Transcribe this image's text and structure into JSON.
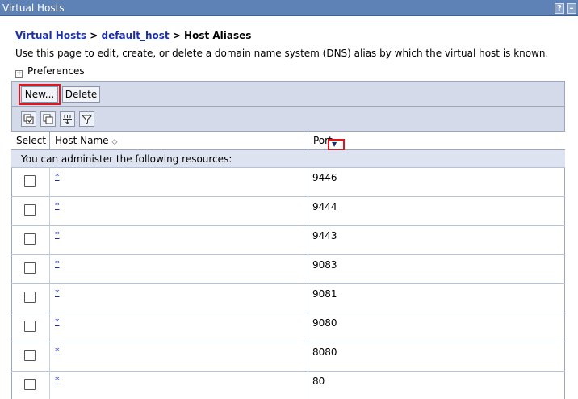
{
  "window": {
    "title": "Virtual Hosts",
    "help_label": "?",
    "minimize_label": "–"
  },
  "breadcrumb": {
    "items": [
      {
        "label": "Virtual Hosts",
        "link": true
      },
      {
        "label": " > ",
        "link": false
      },
      {
        "label": "default_host",
        "link": true
      },
      {
        "label": " > ",
        "link": false
      },
      {
        "label": "Host Aliases",
        "link": false
      }
    ]
  },
  "description": "Use this page to edit, create, or delete a domain name system (DNS) alias by which the virtual host is known.",
  "preferences": {
    "label": "Preferences",
    "toggle": "+"
  },
  "toolbar": {
    "new_label": "New...",
    "delete_label": "Delete"
  },
  "icon_toolbar": [
    "select-all-icon",
    "deselect-all-icon",
    "show-filter-icon",
    "clear-filter-icon"
  ],
  "table": {
    "columns": {
      "select": "Select",
      "host": "Host Name",
      "port": "Port"
    },
    "sort_indicator": "◇",
    "port_menu_icon": "▼",
    "resource_message": "You can administer the following resources:",
    "rows": [
      {
        "host": "*",
        "port": "9446"
      },
      {
        "host": "*",
        "port": "9444"
      },
      {
        "host": "*",
        "port": "9443"
      },
      {
        "host": "*",
        "port": "9083"
      },
      {
        "host": "*",
        "port": "9081"
      },
      {
        "host": "*",
        "port": "9080"
      },
      {
        "host": "*",
        "port": "8080"
      },
      {
        "host": "*",
        "port": "80"
      }
    ]
  },
  "colors": {
    "titlebar": "#5e82b5",
    "toolbar": "#d4daea",
    "link": "#1c2fa8",
    "highlight": "#e0151d"
  }
}
